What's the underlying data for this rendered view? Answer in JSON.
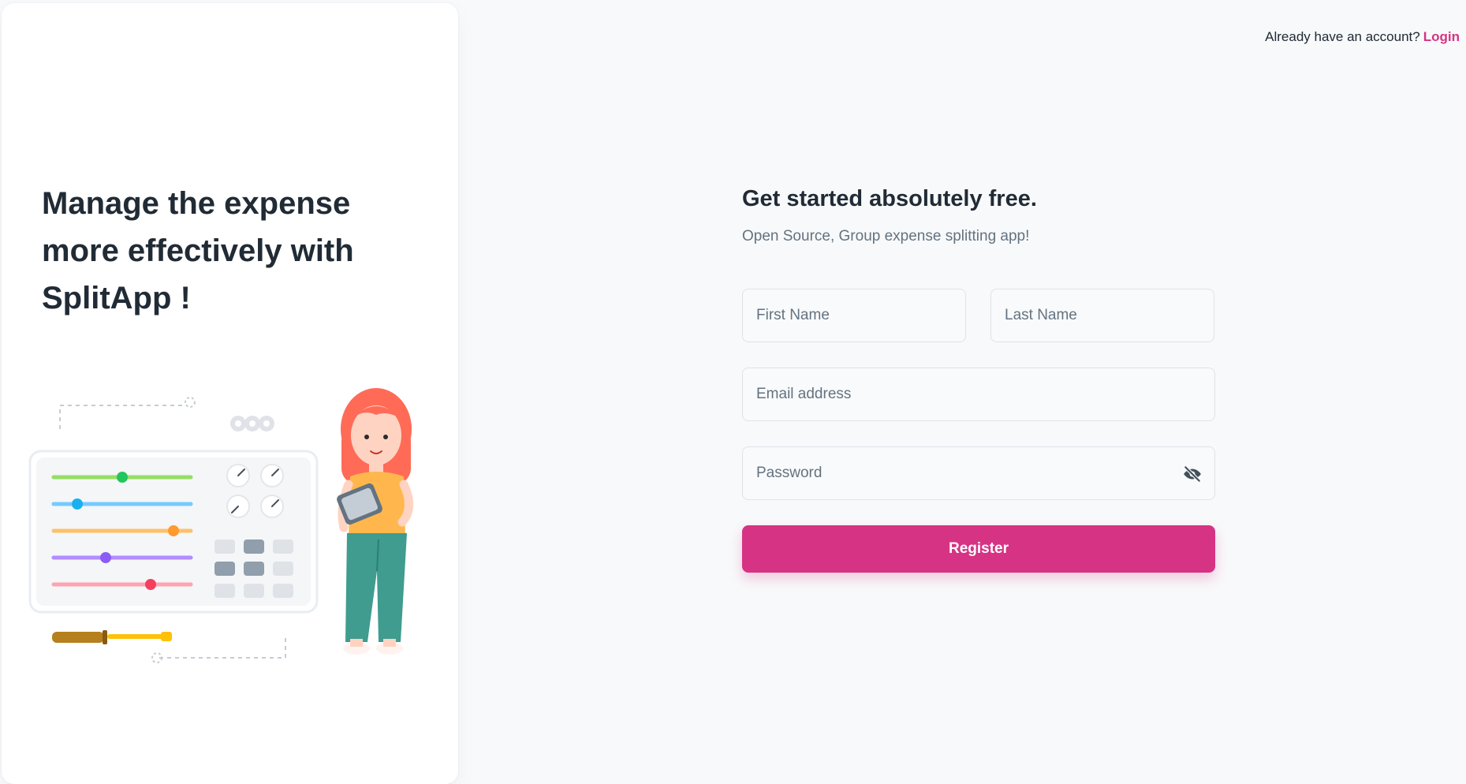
{
  "hero": {
    "headline": "Manage the expense more effectively with SplitApp !"
  },
  "header": {
    "prompt": "Already have an account?",
    "login_label": "Login"
  },
  "form": {
    "title": "Get started absolutely free.",
    "subtitle": "Open Source, Group expense splitting app!",
    "first_name_placeholder": "First Name",
    "last_name_placeholder": "Last Name",
    "email_placeholder": "Email address",
    "password_placeholder": "Password",
    "password_toggle_icon": "eye-off-icon",
    "register_label": "Register"
  },
  "colors": {
    "accent": "#d63384",
    "background": "#f8f9fa",
    "text": "#212b36",
    "muted": "#637381"
  }
}
